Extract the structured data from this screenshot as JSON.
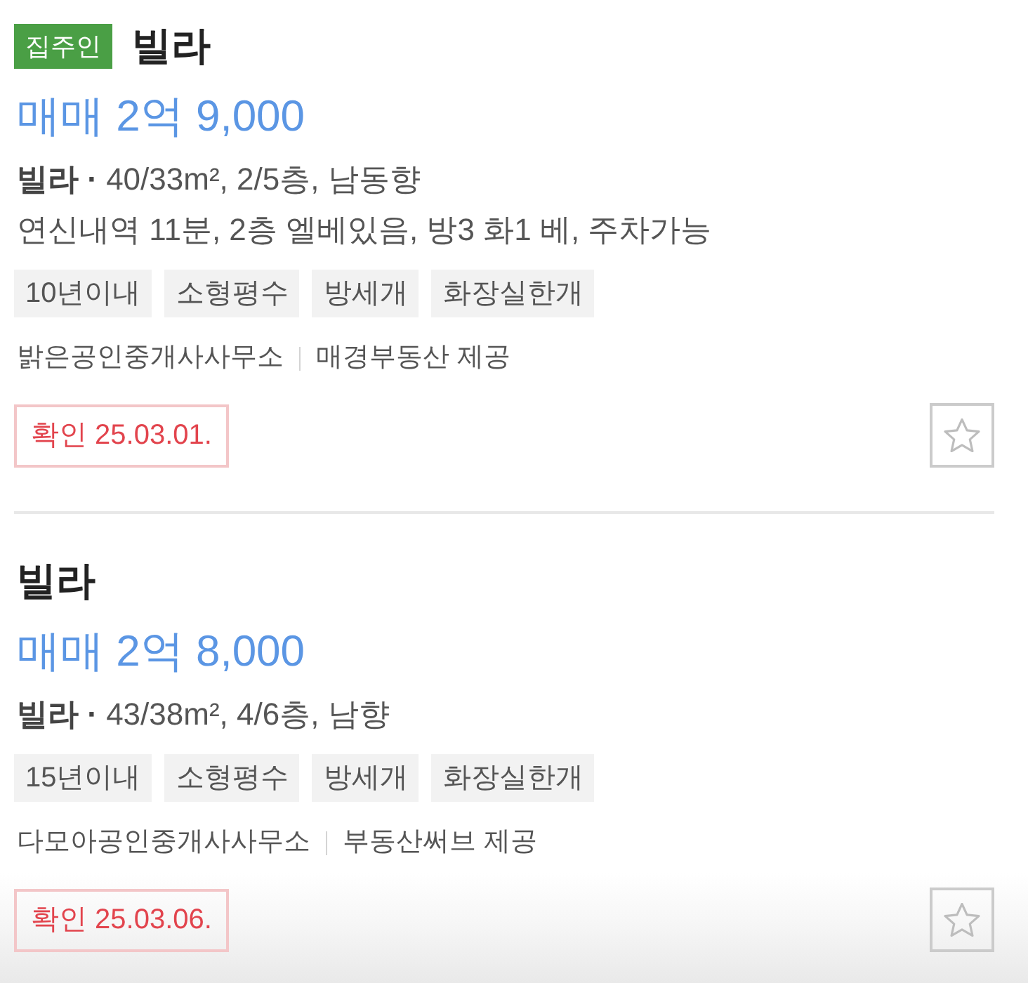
{
  "listings": [
    {
      "owner_badge": "집주인",
      "title": "빌라",
      "price": "매매 2억 9,000",
      "specs": "**빌라 ·** 40/33m², 2/5층, 남동향",
      "description": "연신내역 11분, 2층 엘베있음, 방3 화1 베, 주차가능",
      "tags": [
        "10년이내",
        "소형평수",
        "방세개",
        "화장실한개"
      ],
      "agency": "밝은공인중개사사무소",
      "provider": "매경부동산 제공",
      "confirmed": "확인 25.03.01.",
      "favorited": false
    },
    {
      "title": "빌라",
      "price": "매매 2억 8,000",
      "specs": "**빌라 ·** 43/38m², 4/6층, 남향",
      "tags": [
        "15년이내",
        "소형평수",
        "방세개",
        "화장실한개"
      ],
      "agency": "다모아공인중개사사무소",
      "provider": "부동산써브 제공",
      "confirmed": "확인 25.03.06.",
      "favorited": false
    }
  ]
}
